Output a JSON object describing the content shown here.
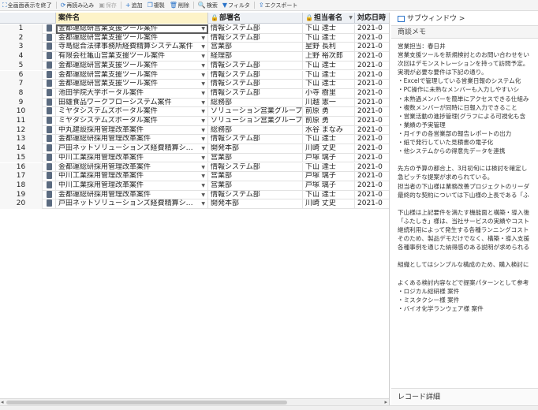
{
  "toolbar": {
    "items": [
      {
        "label": "全画面表示を終了",
        "icon": "fullscreen-exit-icon",
        "disabled": false
      },
      {
        "label": "再読み込み",
        "icon": "reload-icon",
        "disabled": false
      },
      {
        "label": "保存",
        "icon": "save-icon",
        "disabled": true
      },
      {
        "label": "追加",
        "icon": "plus-icon",
        "disabled": false
      },
      {
        "label": "複製",
        "icon": "copy-icon",
        "disabled": false
      },
      {
        "label": "削除",
        "icon": "trash-icon",
        "disabled": false
      },
      {
        "label": "検索",
        "icon": "search-icon",
        "disabled": false
      },
      {
        "label": "フィルタ",
        "icon": "filter-icon",
        "disabled": false
      },
      {
        "label": "エクスポート",
        "icon": "export-icon",
        "disabled": false
      }
    ]
  },
  "grid": {
    "columns": [
      "案件名",
      "部署名",
      "担当者名",
      "対応日時"
    ],
    "rows": [
      {
        "no": "1",
        "name": "金都運総研営業支援ツール案件",
        "dept": "情報システム部",
        "person": "下山 達士",
        "date": "2021-0"
      },
      {
        "no": "2",
        "name": "金都運総研営業支援ツール案件",
        "dept": "情報システム部",
        "person": "下山 達士",
        "date": "2021-0"
      },
      {
        "no": "3",
        "name": "寺島総合法律事務所経費精算システム案件",
        "dept": "営業部",
        "person": "星野 長利",
        "date": "2021-0"
      },
      {
        "no": "4",
        "name": "有限会社亀山営業支援ツール案件",
        "dept": "経理部",
        "person": "上野 裕次郎",
        "date": "2021-0"
      },
      {
        "no": "5",
        "name": "金都運総研営業支援ツール案件",
        "dept": "情報システム部",
        "person": "下山 達士",
        "date": "2021-0"
      },
      {
        "no": "6",
        "name": "金都運総研営業支援ツール案件",
        "dept": "情報システム部",
        "person": "下山 達士",
        "date": "2021-0"
      },
      {
        "no": "7",
        "name": "金都運総研営業支援ツール案件",
        "dept": "情報システム部",
        "person": "下山 達士",
        "date": "2021-0"
      },
      {
        "no": "8",
        "name": "池田学院大学ポータル案件",
        "dept": "情報システム部",
        "person": "小寺 樹里",
        "date": "2021-0"
      },
      {
        "no": "9",
        "name": "田雄食品ワークフローシステム案件",
        "dept": "総務部",
        "person": "川越 憲一",
        "date": "2021-0"
      },
      {
        "no": "10",
        "name": "ミヤタシステムズポータル案件",
        "dept": "ソリューション営業グループ",
        "person": "前原 勇",
        "date": "2021-0"
      },
      {
        "no": "11",
        "name": "ミヤタシステムズポータル案件",
        "dept": "ソリューション営業グループ",
        "person": "前原 勇",
        "date": "2021-0"
      },
      {
        "no": "12",
        "name": "中丸建設採用管理改革案件",
        "dept": "総務部",
        "person": "水谷 まなみ",
        "date": "2021-0"
      },
      {
        "no": "13",
        "name": "金都運総研採用管理改革案件",
        "dept": "情報システム部",
        "person": "下山 達士",
        "date": "2021-0"
      },
      {
        "no": "14",
        "name": "戸田ネットソリューションズ経費精算シ…",
        "dept": "開発本部",
        "person": "川崎 丈史",
        "date": "2021-0"
      },
      {
        "no": "15",
        "name": "中川工業採用管理改革案件",
        "dept": "営業部",
        "person": "戸塚 璃子",
        "date": "2021-0"
      },
      {
        "no": "16",
        "name": "金都運総研採用管理改革案件",
        "dept": "情報システム部",
        "person": "下山 達士",
        "date": "2021-0"
      },
      {
        "no": "17",
        "name": "中川工業採用管理改革案件",
        "dept": "営業部",
        "person": "戸塚 璃子",
        "date": "2021-0"
      },
      {
        "no": "18",
        "name": "中川工業採用管理改革案件",
        "dept": "営業部",
        "person": "戸塚 璃子",
        "date": "2021-0"
      },
      {
        "no": "19",
        "name": "金都運総研採用管理改革案件",
        "dept": "情報システム部",
        "person": "下山 達士",
        "date": "2021-0"
      },
      {
        "no": "20",
        "name": "戸田ネットソリューションズ経費精算シ…",
        "dept": "開発本部",
        "person": "川崎 丈史",
        "date": "2021-0"
      }
    ]
  },
  "panel": {
    "title": "サブウィンドウ >",
    "subtitle": "商談メモ",
    "footer": "レコード詳細",
    "memo_lines": [
      "営業担当：春日井",
      "営業支援ツールを新規検討とのお問い合わせをい",
      "次回はデモンストレーションを持って訪問予定。",
      "実現が必要な要件は下記の通り。",
      "・Excelで管理している営業日報のシステム化",
      "・PC操作に未熟なメンバーも入力しやすいシ",
      "・未熟過メンバーを簡単にアクセスできる仕組み",
      "・複数メンバーが同時に日報入力できること",
      "・営業活動の進捗管理(グラフによる可視化も含",
      "・業績の予実管理",
      "・月イチの各営業部の報告レポートの出力",
      "・紙で発行していた見積書の電子化",
      "・他システムからの得意先データを連携",
      "",
      "先方の予算の都合上、3月初旬には検討を確定し",
      "急ピッチな提案が求められている。",
      "担当者の下山様は業務改善プロジェクトのリーダ",
      "最終的な契約については下山様の上長である「ふ",
      "",
      "下山様は上記要件を満たす機能面と構築・導入後",
      "「ふたしき」様は、当社サービスの実績やコスト",
      "継続利用によって発生する各種ランニングコスト",
      "そのため、製品デモだけでなく、構築・導入支援",
      "各種事例を通じた納得感のある説明が求められる",
      "",
      "組織としてはシンプルな構成のため、購入検討に",
      "",
      "よくある検討内容などで提案パターンとして参考",
      "・ロジカル総研様 案件",
      "・ミスタクシー様 案件",
      "・バイオ化学ランウェア様 案件"
    ]
  }
}
